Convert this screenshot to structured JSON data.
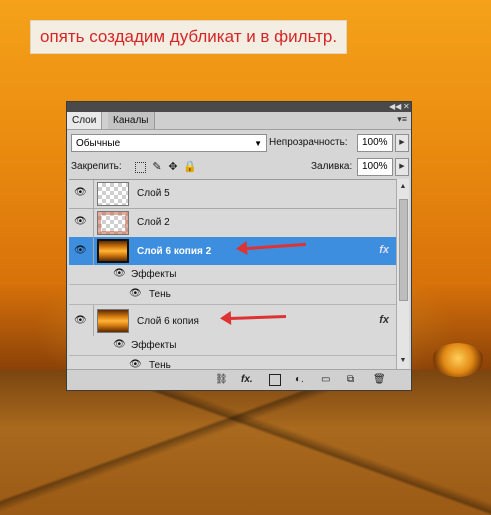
{
  "caption": "опять создадим дубликат и в фильтр.",
  "panel": {
    "tabs": [
      {
        "label": "Слои"
      },
      {
        "label": "Каналы"
      }
    ],
    "collapse_icon": "double-arrow-icon",
    "close_icon": "close-icon",
    "menu_icon": "panel-menu-icon",
    "blend_mode": "Обычные",
    "opacity_label": "Непрозрачность:",
    "opacity_value": "100%",
    "lock_label": "Закрепить:",
    "fill_label": "Заливка:",
    "fill_value": "100%",
    "layers": [
      {
        "name": "Слой 5",
        "thumb": "checker",
        "selected": false,
        "fx": ""
      },
      {
        "name": "Слой 2",
        "thumb": "checker-red",
        "selected": false,
        "fx": ""
      },
      {
        "name": "Слой 6 копия 2",
        "thumb": "band",
        "selected": true,
        "fx": "fx",
        "effects_label": "Эффекты",
        "effect": "Тень"
      },
      {
        "name": "Слой 6 копия",
        "thumb": "band",
        "selected": false,
        "fx": "fx",
        "effects_label": "Эффекты",
        "effect": "Тень"
      }
    ],
    "bottom_icons": [
      "link-icon",
      "fx-icon",
      "mask-icon",
      "adjustment-icon",
      "group-icon",
      "new-layer-icon",
      "trash-icon"
    ],
    "accent_selected": "#3e8ee0",
    "arrow_color": "#dd3333"
  }
}
